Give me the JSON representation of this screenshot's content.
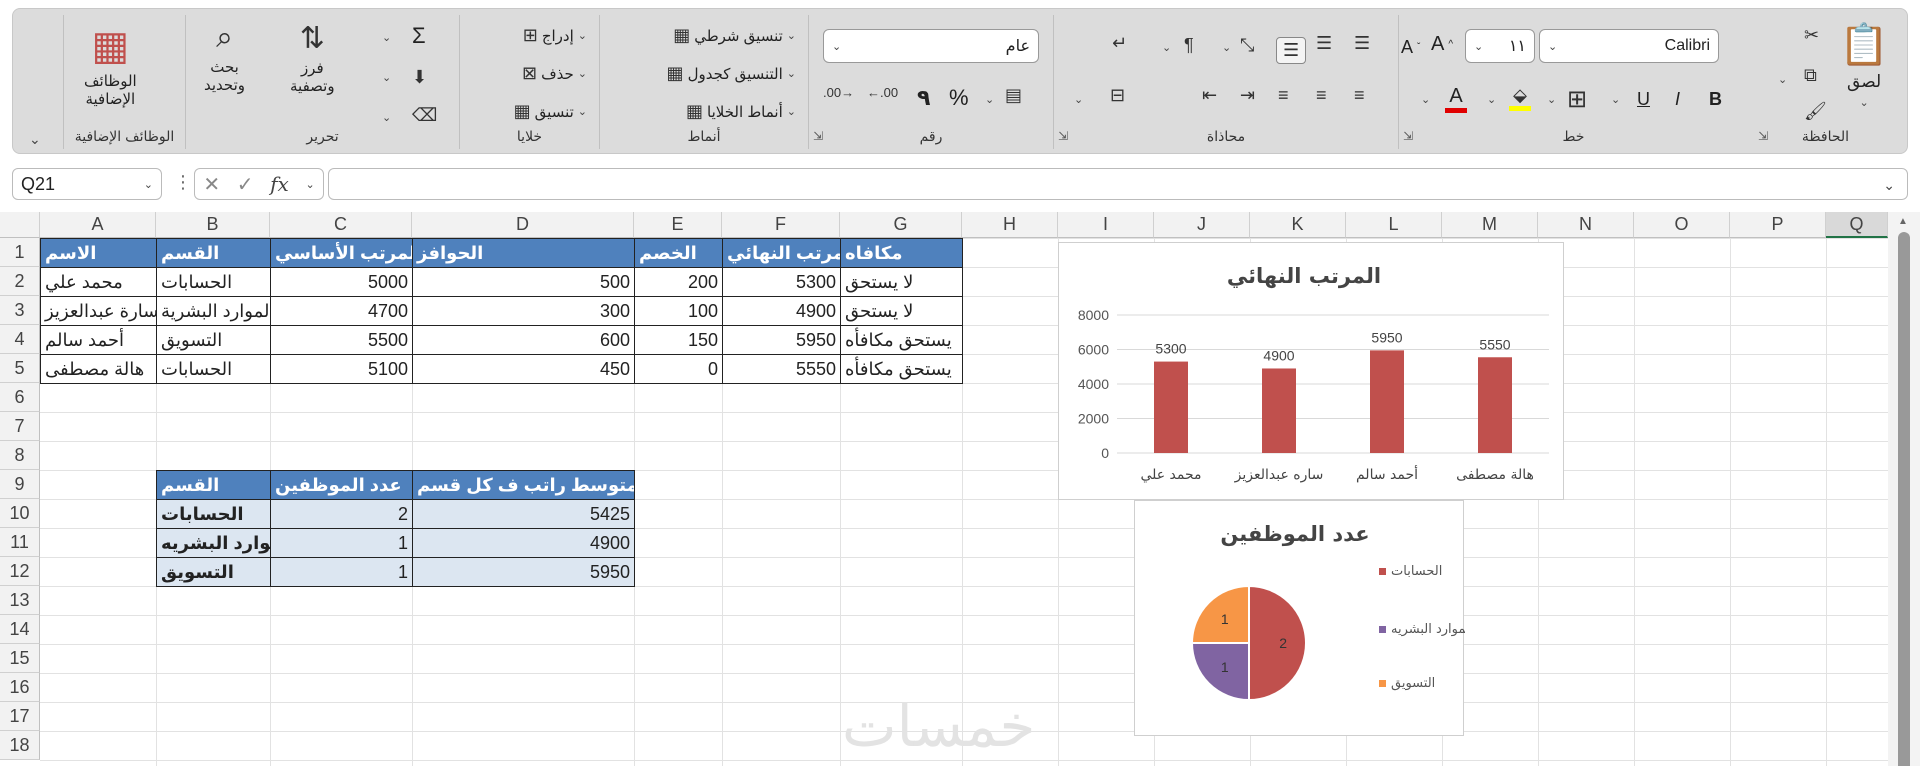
{
  "ribbon": {
    "clipboard": {
      "group": "الحافظة",
      "paste": "لصق"
    },
    "font": {
      "group": "خط",
      "name": "Calibri",
      "size": "١١",
      "bold": "B",
      "italic": "I",
      "underline": "U",
      "grow": "A^",
      "shrink": "Aˇ"
    },
    "alignment": {
      "group": "محاذاة"
    },
    "number": {
      "group": "رقم",
      "format": "عام",
      "percent": "%",
      "comma": "٩"
    },
    "styles": {
      "group": "أنماط",
      "conditional": "تنسيق شرطي",
      "as_table": "التنسيق كجدول",
      "cell_styles": "أنماط الخلايا"
    },
    "cells": {
      "group": "خلايا",
      "insert": "إدراج",
      "delete": "حذف",
      "format": "تنسيق"
    },
    "editing": {
      "group": "تحرير",
      "sum": "Σ",
      "sort": "فرز\nوتصفية",
      "find": "بحث\nوتحديد"
    },
    "addins": {
      "group": "الوظائف الإضافية",
      "label": "الوظائف\nالإضافية"
    }
  },
  "namebox": "Q21",
  "columns": [
    "A",
    "B",
    "C",
    "D",
    "E",
    "F",
    "G",
    "H",
    "I",
    "J",
    "K",
    "L",
    "M",
    "N",
    "O",
    "P",
    "Q"
  ],
  "rows": [
    "1",
    "2",
    "3",
    "4",
    "5",
    "6",
    "7",
    "8",
    "9",
    "10",
    "11",
    "12",
    "13",
    "14",
    "15",
    "16",
    "17",
    "18"
  ],
  "table1": {
    "headers": [
      "الاسم",
      "القسم",
      "المرتب الأساسي",
      "الحوافز",
      "الخصم",
      "المرتب النهائي",
      "مكافاه"
    ],
    "rows": [
      [
        "محمد علي",
        "الحسابات",
        "5000",
        "500",
        "200",
        "5300",
        "لا يستحق"
      ],
      [
        "سارة عبدالعزيز",
        "الموارد البشرية",
        "4700",
        "300",
        "100",
        "4900",
        "لا يستحق"
      ],
      [
        "أحمد سالم",
        "التسويق",
        "5500",
        "600",
        "150",
        "5950",
        "يستحق مكافأه"
      ],
      [
        "هالة مصطفى",
        "الحسابات",
        "5100",
        "450",
        "0",
        "5550",
        "يستحق مكافأه"
      ]
    ]
  },
  "table2": {
    "headers": [
      "القسم",
      "عدد الموظفين",
      "متوسط راتب ف كل قسم"
    ],
    "rows": [
      [
        "الحسابات",
        "2",
        "5425"
      ],
      [
        "الموارد البشريه",
        "1",
        "4900"
      ],
      [
        "التسويق",
        "1",
        "5950"
      ]
    ]
  },
  "chart_data": [
    {
      "type": "bar",
      "title": "المرتب النهائي",
      "categories": [
        "محمد علي",
        "ساره عبدالعزيز",
        "أحمد سالم",
        "هالة مصطفى"
      ],
      "values": [
        5300,
        4900,
        5950,
        5550
      ],
      "yticks": [
        "0",
        "2000",
        "4000",
        "6000",
        "8000"
      ],
      "ylim": [
        0,
        8000
      ],
      "color": "#c0504d",
      "grid": true
    },
    {
      "type": "pie",
      "title": "عدد الموظفين",
      "categories": [
        "الحسابات",
        "الموارد البشريه",
        "التسويق"
      ],
      "values": [
        2,
        1,
        1
      ],
      "colors": [
        "#c0504d",
        "#8064a2",
        "#f79646"
      ],
      "legend": "right"
    }
  ],
  "watermark": "خمسات"
}
